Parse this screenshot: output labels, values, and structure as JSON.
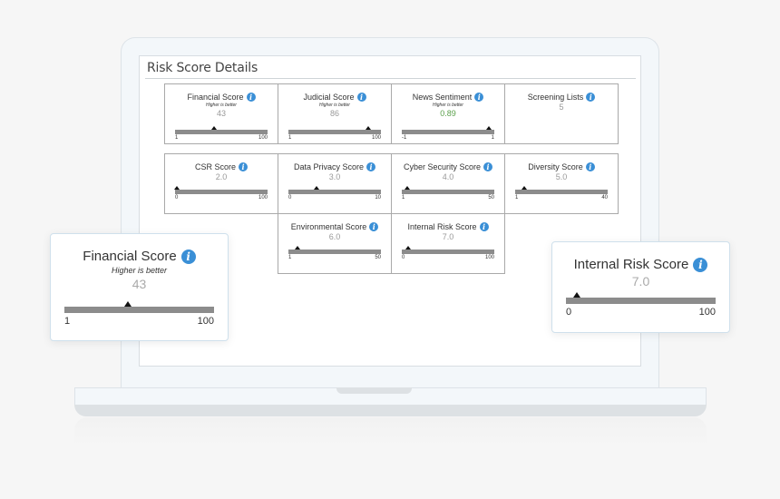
{
  "panel": {
    "title": "Risk Score Details"
  },
  "cards": [
    {
      "title": "Financial Score",
      "hint": "Higher is better",
      "value": "43",
      "value_num": 43,
      "min": "1",
      "max": "100",
      "min_num": 1,
      "max_num": 100,
      "color": "#999999",
      "gauge": true
    },
    {
      "title": "Judicial Score",
      "hint": "Higher is better",
      "value": "86",
      "value_num": 86,
      "min": "1",
      "max": "100",
      "min_num": 1,
      "max_num": 100,
      "color": "#999999",
      "gauge": true
    },
    {
      "title": "News Sentiment",
      "hint": "Higher is better",
      "value": "0.89",
      "value_num": 0.89,
      "min": "-1",
      "max": "1",
      "min_num": -1,
      "max_num": 1,
      "color": "#5aa04b",
      "gauge": true
    },
    {
      "title": "Screening Lists",
      "hint": null,
      "value": "5",
      "gauge": false
    },
    {
      "title": "CSR Score",
      "hint": null,
      "value": "2.0",
      "value_num": 2.0,
      "min": "0",
      "max": "100",
      "min_num": 0,
      "max_num": 100,
      "color": "#999999",
      "gauge": true
    },
    {
      "title": "Data Privacy Score",
      "hint": null,
      "value": "3.0",
      "value_num": 3.0,
      "min": "0",
      "max": "10",
      "min_num": 0,
      "max_num": 10,
      "color": "#999999",
      "gauge": true
    },
    {
      "title": "Cyber Security Score",
      "hint": null,
      "value": "4.0",
      "value_num": 4.0,
      "min": "1",
      "max": "50",
      "min_num": 1,
      "max_num": 50,
      "color": "#999999",
      "gauge": true
    },
    {
      "title": "Diversity Score",
      "hint": null,
      "value": "5.0",
      "value_num": 5.0,
      "min": "1",
      "max": "40",
      "min_num": 1,
      "max_num": 40,
      "color": "#999999",
      "gauge": true
    },
    {
      "title": "Environmental Score",
      "hint": null,
      "value": "6.0",
      "value_num": 6.0,
      "min": "1",
      "max": "50",
      "min_num": 1,
      "max_num": 50,
      "color": "#999999",
      "gauge": true
    },
    {
      "title": "Internal Risk Score",
      "hint": null,
      "value": "7.0",
      "value_num": 7.0,
      "min": "0",
      "max": "100",
      "min_num": 0,
      "max_num": 100,
      "color": "#999999",
      "gauge": true
    }
  ],
  "popups": {
    "left": {
      "title": "Financial Score",
      "hint": "Higher is better",
      "value": "43",
      "value_num": 43,
      "min": "1",
      "max": "100",
      "min_num": 1,
      "max_num": 100
    },
    "right": {
      "title": "Internal Risk Score",
      "value": "7.0",
      "value_num": 7.0,
      "min": "0",
      "max": "100",
      "min_num": 0,
      "max_num": 100
    }
  },
  "icons": {
    "info": "i"
  },
  "colors": {
    "accent_info": "#3a8fd6",
    "positive": "#5aa04b",
    "muted_value": "#999999",
    "gauge_bar": "#8c8c8c"
  }
}
